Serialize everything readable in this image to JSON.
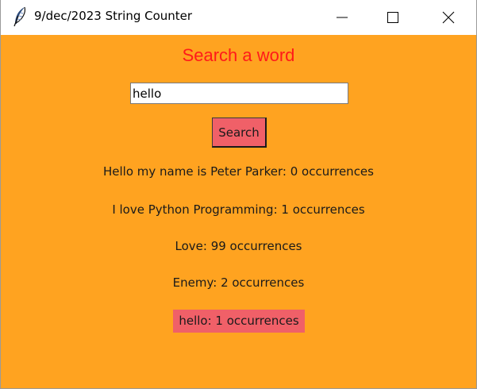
{
  "window": {
    "title": "9/dec/2023 String Counter",
    "icon": "feather-icon"
  },
  "main": {
    "heading": "Search a word",
    "search_value": "hello",
    "search_button_label": "Search",
    "results": [
      "Hello my name is Peter Parker: 0 occurrences",
      "I love Python Programming: 1 occurrences",
      "Love: 99 occurrences",
      "Enemy: 2 occurrences",
      "hello: 1 occurrences"
    ]
  },
  "colors": {
    "background": "#ffa320",
    "heading": "#ff1a1a",
    "button": "#f06068",
    "highlight": "#f06068"
  }
}
